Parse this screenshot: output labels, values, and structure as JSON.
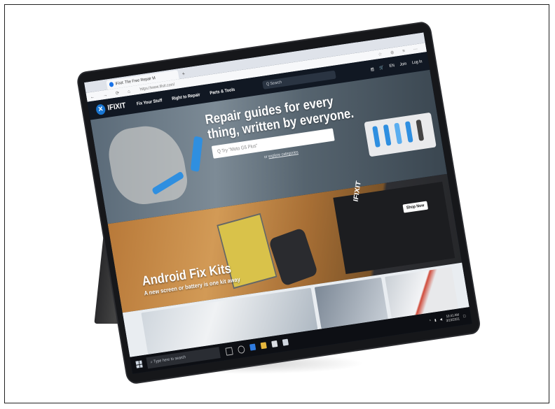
{
  "browser": {
    "tab_title": "iFixit: The Free Repair M",
    "new_tab": "+",
    "url": "https://www.ifixit.com/",
    "nav_glyphs": "← → ⟳ ⌂",
    "tool_glyphs": "☆ ⊕ ≡ ⋯"
  },
  "site": {
    "logo_text": "IFIXIT",
    "nav": [
      "Fix Your Stuff",
      "Right to Repair",
      "Parts & Tools"
    ],
    "search_placeholder": "Q  Search",
    "header_right": [
      "▤",
      "🛒",
      "EN",
      "Join",
      "Log In"
    ]
  },
  "hero": {
    "title": "Repair guides for every thing, written by everyone.",
    "search_placeholder": "Q   Try \"Moto G5 Plus\"",
    "sub_prefix": "or ",
    "sub_link": "explore categories"
  },
  "promo": {
    "title": "Android Fix Kits",
    "subtitle": "A new screen or battery is one kit away",
    "shop_label": "Shop Now",
    "box_logo": "IFIXIT"
  },
  "taskbar": {
    "search_placeholder": "⌕  Type here to search",
    "time": "10:41 AM",
    "date": "3/10/2021"
  },
  "colors": {
    "brand_blue": "#1976d2",
    "header_bg": "#111823",
    "taskbar_bg": "#0d0f14"
  }
}
